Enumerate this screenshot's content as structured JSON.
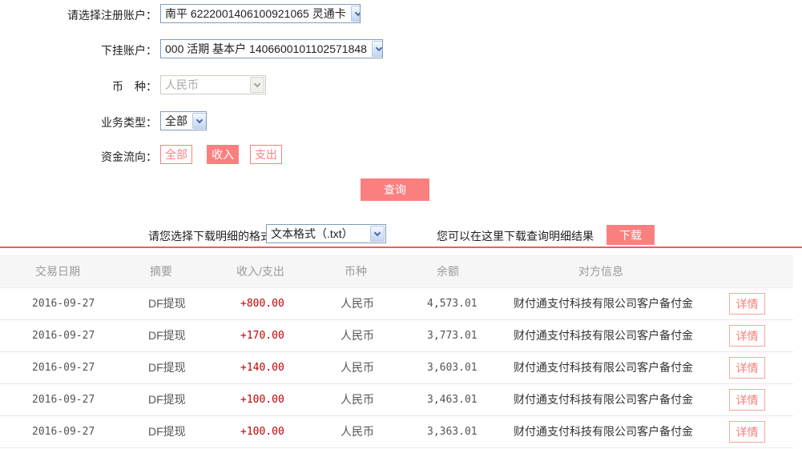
{
  "colors": {
    "accent_pink": "#fa8080",
    "amount_red": "#c40000",
    "divider_red": "#f25c5c",
    "select_border_blue": "#7f9db9",
    "header_bg": "#f6f6f6",
    "header_text": "#9b9b9b"
  },
  "form": {
    "registered_account": {
      "label": "请选择注册账户：",
      "value": "南平 6222001406100921065 灵通卡"
    },
    "sub_account": {
      "label": "下挂账户：",
      "value": "000 活期 基本户 1406600101102571848"
    },
    "currency": {
      "label": "币　种：",
      "value": "人民币",
      "disabled": true
    },
    "business_type": {
      "label": "业务类型：",
      "value": "全部"
    },
    "fund_direction": {
      "label": "资金流向：",
      "options": [
        "全部",
        "收入",
        "支出"
      ],
      "selected": "收入"
    }
  },
  "query_button_label": "查询",
  "download": {
    "format_label": "请您选择下载明细的格式",
    "format_value": "文本格式（.txt）",
    "hint": "您可以在这里下载查询明细结果",
    "button_label": "下载"
  },
  "table": {
    "headers": [
      "交易日期",
      "摘要",
      "收入/支出",
      "币种",
      "余额",
      "对方信息"
    ],
    "detail_label": "详情",
    "rows": [
      {
        "date": "2016-09-27",
        "summary": "DF提现",
        "amount": "+800.00",
        "currency": "人民币",
        "balance": "4,573.01",
        "counterparty": "财付通支付科技有限公司客户备付金"
      },
      {
        "date": "2016-09-27",
        "summary": "DF提现",
        "amount": "+170.00",
        "currency": "人民币",
        "balance": "3,773.01",
        "counterparty": "财付通支付科技有限公司客户备付金"
      },
      {
        "date": "2016-09-27",
        "summary": "DF提现",
        "amount": "+140.00",
        "currency": "人民币",
        "balance": "3,603.01",
        "counterparty": "财付通支付科技有限公司客户备付金"
      },
      {
        "date": "2016-09-27",
        "summary": "DF提现",
        "amount": "+100.00",
        "currency": "人民币",
        "balance": "3,463.01",
        "counterparty": "财付通支付科技有限公司客户备付金"
      },
      {
        "date": "2016-09-27",
        "summary": "DF提现",
        "amount": "+100.00",
        "currency": "人民币",
        "balance": "3,363.01",
        "counterparty": "财付通支付科技有限公司客户备付金"
      }
    ]
  }
}
